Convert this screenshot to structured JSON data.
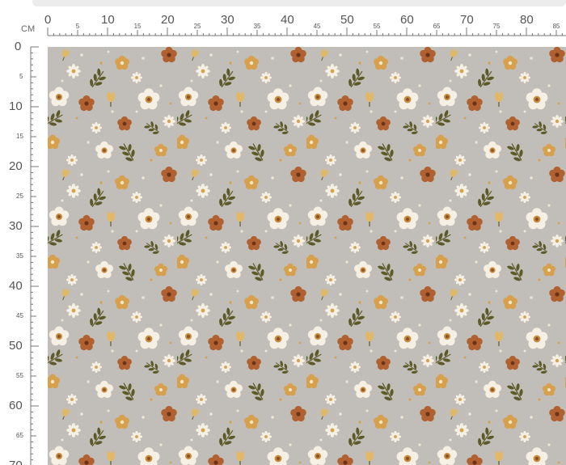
{
  "ruler": {
    "unit": "CM",
    "top_major": [
      "0",
      "10",
      "20",
      "30",
      "40",
      "50",
      "60",
      "70",
      "80"
    ],
    "top_minor": [
      "5",
      "15",
      "25",
      "35",
      "45",
      "55",
      "65",
      "75",
      "85"
    ],
    "left_major": [
      "0",
      "10",
      "20",
      "30",
      "40",
      "50",
      "60",
      "70"
    ],
    "left_minor": [
      "5",
      "15",
      "25",
      "35",
      "45",
      "55",
      "65"
    ]
  },
  "fabric": {
    "name": "floral-fabric-swatch",
    "colors": {
      "background": "#c1bdb8",
      "cream": "#f6efe3",
      "rust": "#b0612f",
      "mustard": "#d7a04c",
      "olive": "#5c5a28",
      "dot": "#efe6d6"
    }
  }
}
